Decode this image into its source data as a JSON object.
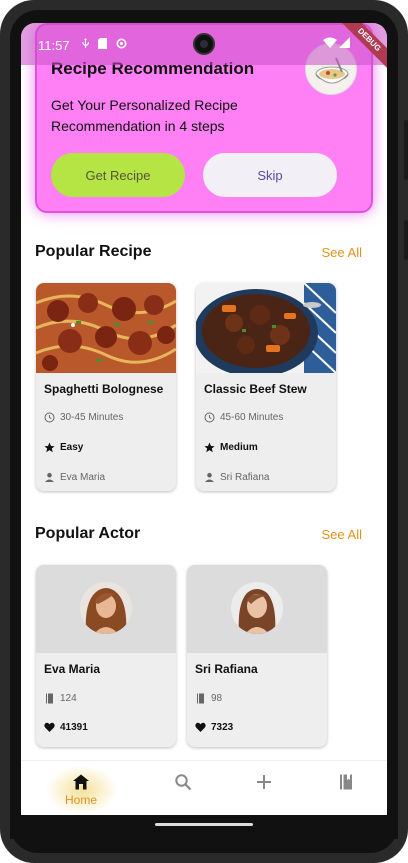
{
  "status_bar": {
    "time": "11:57",
    "debug_label": "DEBUG"
  },
  "promo": {
    "title": "Recipe Recommendation",
    "subtitle": "Get Your Personalized Recipe Recommendation in 4 steps",
    "primary_button": "Get Recipe",
    "secondary_button": "Skip"
  },
  "popular_recipe": {
    "title": "Popular Recipe",
    "see_all": "See All",
    "items": [
      {
        "name": "Spaghetti Bolognese",
        "duration": "30-45 Minutes",
        "difficulty": "Easy",
        "author": "Eva Maria"
      },
      {
        "name": "Classic Beef Stew",
        "duration": "45-60 Minutes",
        "difficulty": "Medium",
        "author": "Sri Rafiana"
      }
    ]
  },
  "popular_actor": {
    "title": "Popular Actor",
    "see_all": "See All",
    "items": [
      {
        "name": "Eva Maria",
        "recipes": "124",
        "likes": "41391"
      },
      {
        "name": "Sri Rafiana",
        "recipes": "98",
        "likes": "7323"
      }
    ]
  },
  "bottom_nav": {
    "home_label": "Home",
    "active": "home"
  },
  "colors": {
    "accent": "#e0921c",
    "promo_bg": "#ff80f5",
    "get_recipe_button": "#b4e544",
    "skip_text": "#5b4a9c"
  }
}
